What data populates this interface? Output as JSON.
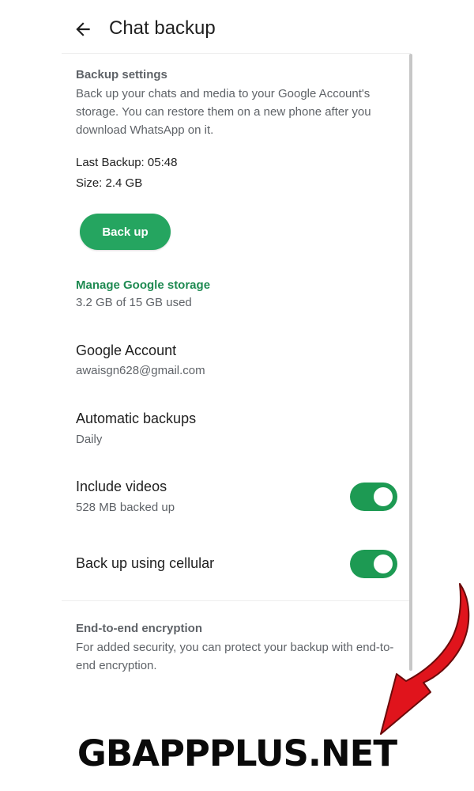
{
  "header": {
    "title": "Chat backup",
    "back_icon": "arrow-back-icon"
  },
  "backup_settings": {
    "label": "Backup settings",
    "description": "Back up your chats and media to your Google Account's storage. You can restore them on a new phone after you download WhatsApp on it.",
    "last_backup": "Last Backup: 05:48",
    "size": "Size: 2.4 GB",
    "button_label": "Back up"
  },
  "storage": {
    "link_label": "Manage Google storage",
    "usage": "3.2 GB of 15 GB used"
  },
  "account": {
    "title": "Google Account",
    "value": "awaisgn628@gmail.com"
  },
  "automatic": {
    "title": "Automatic backups",
    "value": "Daily"
  },
  "videos": {
    "title": "Include videos",
    "value": "528 MB backed up",
    "enabled": true
  },
  "cellular": {
    "title": "Back up using cellular",
    "enabled": true
  },
  "encryption": {
    "label": "End-to-end encryption",
    "description": "For added security, you can protect your backup with end-to-end encryption."
  },
  "watermark": {
    "text": "GBAPPPLUS.NET",
    "arrow_icon": "red-curved-arrow-icon"
  },
  "colors": {
    "accent": "#25a560",
    "link": "#1f8a52",
    "toggle": "#1d9a53",
    "arrow": "#e0141c"
  }
}
